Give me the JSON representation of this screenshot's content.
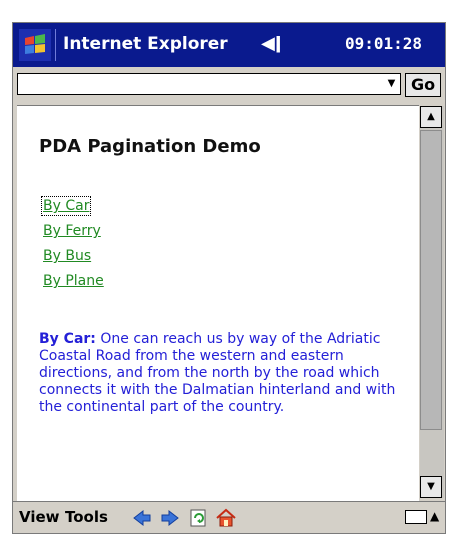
{
  "titlebar": {
    "app_title": "Internet Explorer",
    "clock": "09:01:28",
    "speaker_icon": "speaker-muted-icon"
  },
  "address": {
    "value": "",
    "go_label": "Go"
  },
  "page": {
    "title": "PDA Pagination Demo",
    "links": [
      "By Car",
      "By Ferry",
      "By Bus",
      "By Plane"
    ],
    "para_lead": "By Car:",
    "para_text": " One can reach us by way of the Adriatic Coastal Road from the western and eastern directions, and from the north by the road which connects it with the Dalmatian hinterland and with the continental part of the country."
  },
  "commandbar": {
    "view_label": "View",
    "tools_label": "Tools"
  },
  "colors": {
    "titlebar_bg": "#0a1a8e",
    "link": "#218a23",
    "text_blue": "#2420d7"
  }
}
